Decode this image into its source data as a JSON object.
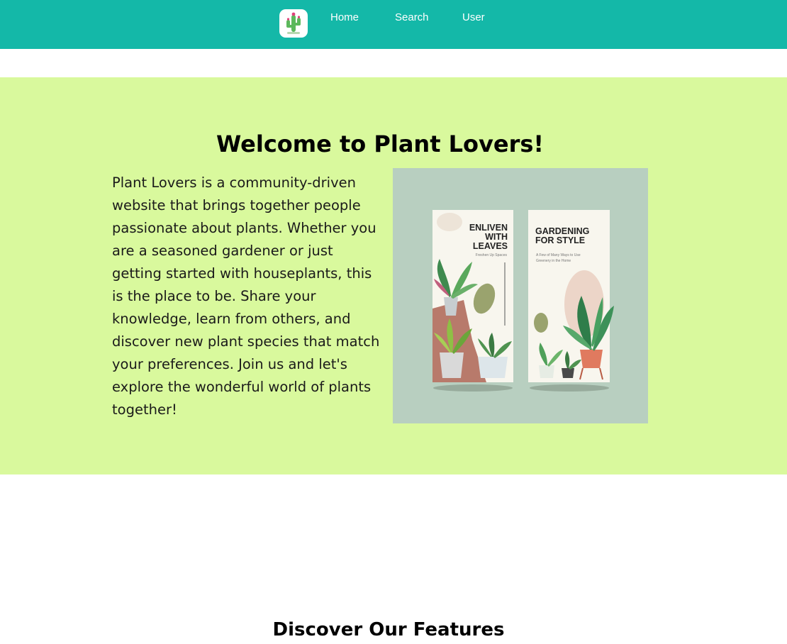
{
  "nav": {
    "items": [
      "Home",
      "Search",
      "User"
    ]
  },
  "hero": {
    "title": "Welcome to Plant Lovers!",
    "text": "Plant Lovers is a community-driven website that brings together people passionate about plants. Whether you are a seasoned gardener or just getting started with houseplants, this is the place to be. Share your knowledge, learn from others, and discover new plant species that match your preferences. Join us and let's explore the wonderful world of plants together!",
    "image": {
      "card1": {
        "title_lines": [
          "ENLIVEN",
          "WITH",
          "LEAVES"
        ],
        "subtitle": "Freshen Up Spaces"
      },
      "card2": {
        "title_lines": [
          "GARDENING",
          "FOR STYLE"
        ],
        "subtitle_lines": [
          "A Few of Many Ways to Use",
          "Greenery in the Home"
        ]
      }
    }
  },
  "features": {
    "title": "Discover Our Features"
  },
  "colors": {
    "navbar": "#14b8a8",
    "hero_background": "#d9f99d",
    "image_background": "#b8cfc0"
  }
}
